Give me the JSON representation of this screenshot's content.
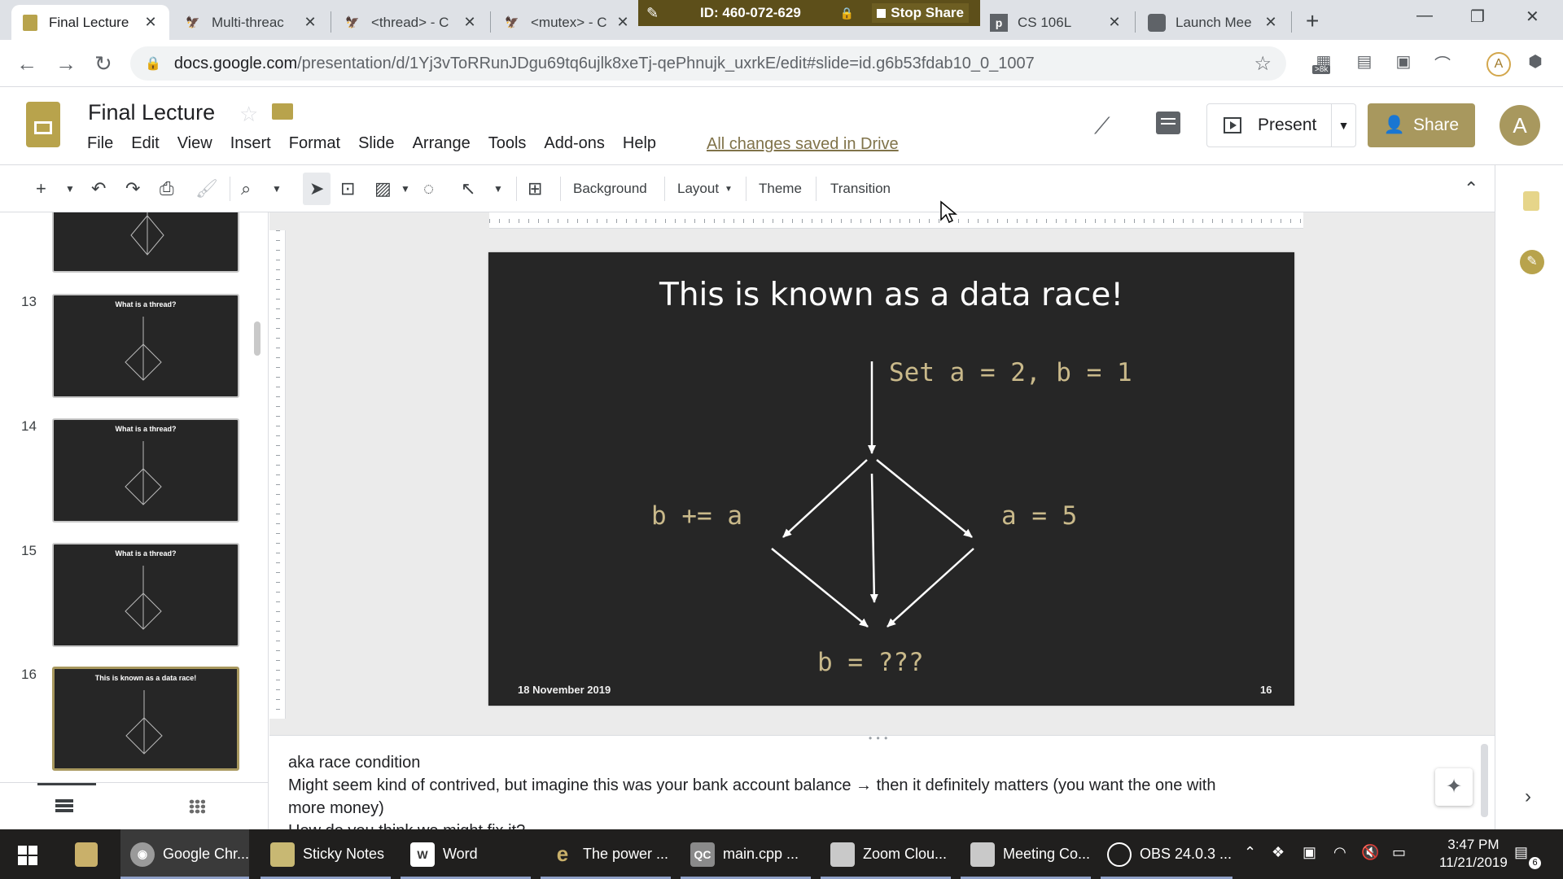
{
  "browser": {
    "tabs": [
      {
        "title": "Final Lecture",
        "icon": "slides-icon",
        "active": true
      },
      {
        "title": "Multi-threac",
        "icon": "tab-favicon-icon",
        "active": false
      },
      {
        "title": "<thread> - C",
        "icon": "tab-favicon-icon",
        "active": false
      },
      {
        "title": "<mutex> - C",
        "icon": "tab-favicon-icon",
        "active": false
      },
      {
        "title": "CS 106L",
        "icon": "piazza-icon",
        "active": false
      },
      {
        "title": "Launch Mee",
        "icon": "zoom-icon",
        "active": false
      }
    ],
    "url_host": "docs.google.com",
    "url_path": "/presentation/d/1Yj3vToRRunJDgu69tq6ujlk8xeTj-qePhnujk_uxrkE/edit#slide=id.g6b53fdab10_0_1007",
    "extension_badge": ">8k",
    "profile_initial": "A"
  },
  "zoom": {
    "meeting_id": "ID: 460-072-629",
    "stop_share": "Stop Share"
  },
  "app": {
    "title": "Final Lecture",
    "menu": [
      "File",
      "Edit",
      "View",
      "Insert",
      "Format",
      "Slide",
      "Arrange",
      "Tools",
      "Add-ons",
      "Help"
    ],
    "save_status": "All changes saved in Drive",
    "present_label": "Present",
    "share_label": "Share",
    "avatar_initial": "A",
    "accent_color": "#a8985e"
  },
  "toolbar": {
    "background": "Background",
    "layout": "Layout",
    "theme": "Theme",
    "transition": "Transition"
  },
  "filmstrip": {
    "thumbs": [
      {
        "number": "",
        "title": ""
      },
      {
        "number": "13",
        "title": "What is a thread?"
      },
      {
        "number": "14",
        "title": "What is a thread?"
      },
      {
        "number": "15",
        "title": "What is a thread?"
      },
      {
        "number": "16",
        "title": "This is known as a data race!",
        "selected": true
      }
    ]
  },
  "slide": {
    "title": "This is known as a data race!",
    "top_label": "Set a = 2, b = 1",
    "left_label": "b += a",
    "right_label": "a = 5",
    "bottom_label": "b = ???",
    "date": "18 November 2019",
    "number": "16"
  },
  "notes": {
    "lines": [
      "aka race condition",
      "Might seem kind of contrived, but imagine this was your bank account balance → then it definitely matters (you want the one with",
      "more money)",
      "How do you think we might fix it?"
    ]
  },
  "taskbar": {
    "items": [
      {
        "label": "",
        "icon": "file-explorer-icon"
      },
      {
        "label": "Google Chr...",
        "icon": "chrome-icon"
      },
      {
        "label": "Sticky Notes",
        "icon": "sticky-notes-icon"
      },
      {
        "label": "Word",
        "icon": "word-icon"
      },
      {
        "label": "The power ...",
        "icon": "edge-icon"
      },
      {
        "label": "main.cpp ...",
        "icon": "qt-creator-icon"
      },
      {
        "label": "Zoom Clou...",
        "icon": "zoom-icon"
      },
      {
        "label": "Meeting Co...",
        "icon": "zoom-icon"
      },
      {
        "label": "OBS 24.0.3 ...",
        "icon": "obs-icon"
      }
    ],
    "time": "3:47 PM",
    "date": "11/21/2019",
    "notification_count": "6"
  }
}
